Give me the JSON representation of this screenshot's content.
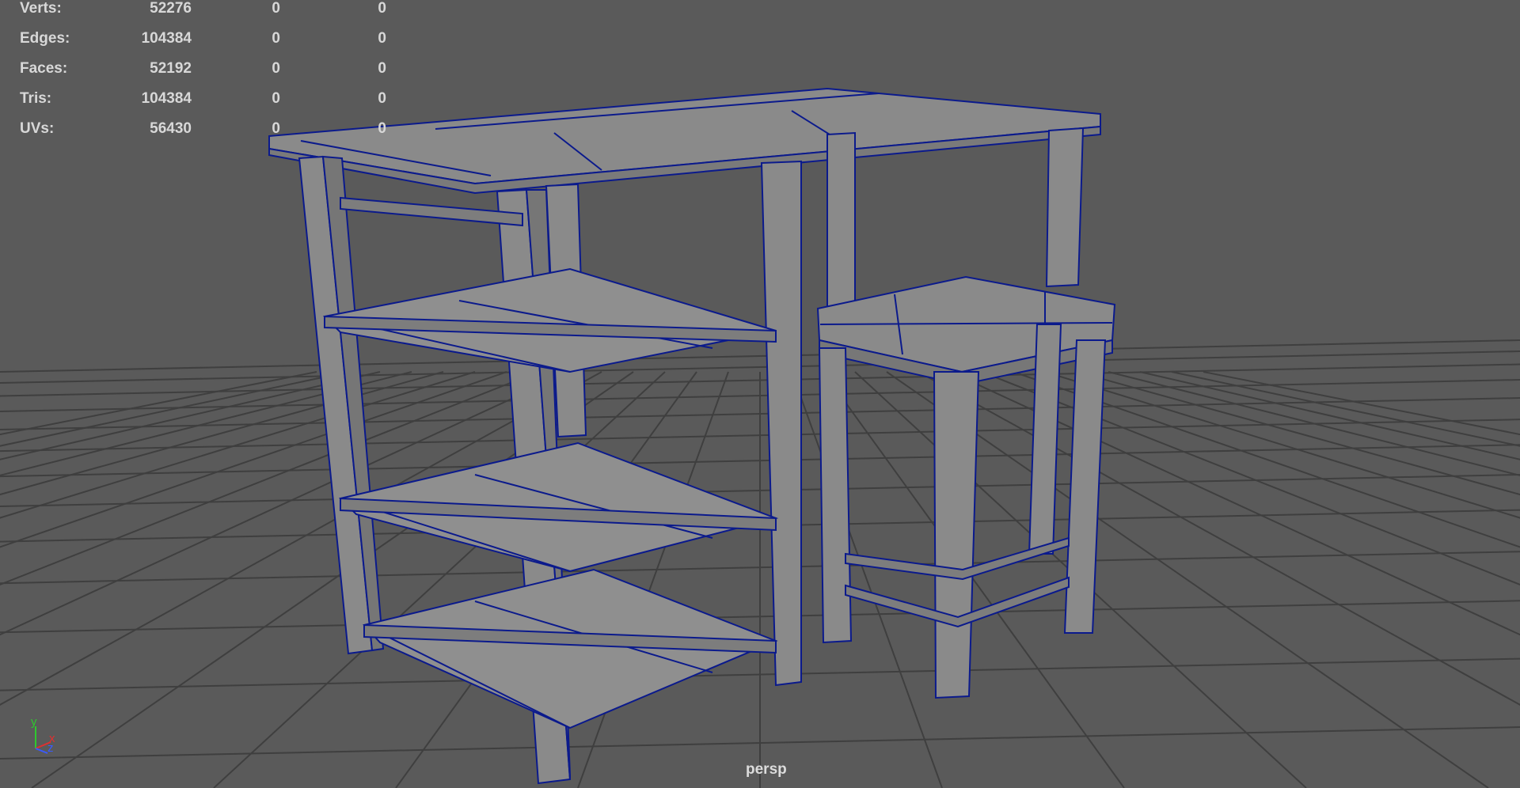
{
  "hud": {
    "rows": [
      {
        "label": "Verts:",
        "total": "52276",
        "selected": "0",
        "selected_2": "0"
      },
      {
        "label": "Edges:",
        "total": "104384",
        "selected": "0",
        "selected_2": "0"
      },
      {
        "label": "Faces:",
        "total": "52192",
        "selected": "0",
        "selected_2": "0"
      },
      {
        "label": "Tris:",
        "total": "104384",
        "selected": "0",
        "selected_2": "0"
      },
      {
        "label": "UVs:",
        "total": "56430",
        "selected": "0",
        "selected_2": "0"
      }
    ]
  },
  "camera": {
    "name": "persp"
  },
  "axis": {
    "y": "y",
    "x": "x",
    "z": "z"
  },
  "colors": {
    "background": "#5a5a5a",
    "grid": "#3f3f3f",
    "wireframe": "#0b1a8c",
    "mesh_fill": "#8a8a8a",
    "hud_text": "#d8d8d8",
    "axis_x": "#e03030",
    "axis_y": "#2ec82e",
    "axis_z": "#3a5aff"
  }
}
